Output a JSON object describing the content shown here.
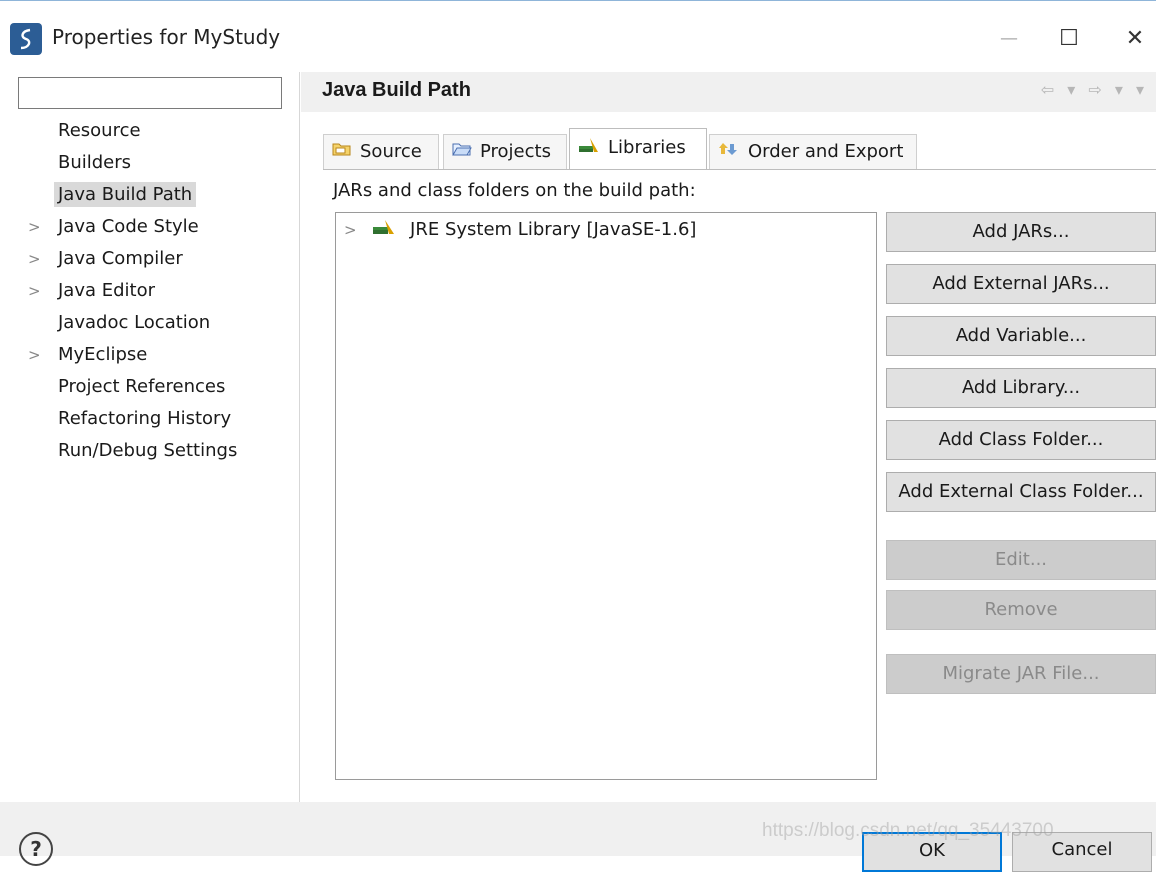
{
  "window": {
    "title": "Properties for MyStudy",
    "minimize": "—",
    "maximize": "☐",
    "close": "✕"
  },
  "nav": {
    "filter_value": "",
    "items": [
      {
        "label": "Resource",
        "expandable": false,
        "selected": false
      },
      {
        "label": "Builders",
        "expandable": false,
        "selected": false
      },
      {
        "label": "Java Build Path",
        "expandable": false,
        "selected": true
      },
      {
        "label": "Java Code Style",
        "expandable": true,
        "selected": false
      },
      {
        "label": "Java Compiler",
        "expandable": true,
        "selected": false
      },
      {
        "label": "Java Editor",
        "expandable": true,
        "selected": false
      },
      {
        "label": "Javadoc Location",
        "expandable": false,
        "selected": false
      },
      {
        "label": "MyEclipse",
        "expandable": true,
        "selected": false
      },
      {
        "label": "Project References",
        "expandable": false,
        "selected": false
      },
      {
        "label": "Refactoring History",
        "expandable": false,
        "selected": false
      },
      {
        "label": "Run/Debug Settings",
        "expandable": false,
        "selected": false
      }
    ],
    "chevron": ">"
  },
  "page": {
    "title": "Java Build Path",
    "history_nav": "⇦ ▾ ⇨ ▾ ▾"
  },
  "tabs": [
    {
      "label": "Source",
      "icon": "source-folder-icon",
      "active": false
    },
    {
      "label": "Projects",
      "icon": "project-folder-icon",
      "active": false
    },
    {
      "label": "Libraries",
      "icon": "library-icon",
      "active": true
    },
    {
      "label": "Order and Export",
      "icon": "order-export-icon",
      "active": false
    }
  ],
  "libraries": {
    "label": "JARs and class folders on the build path:",
    "entries": [
      {
        "label": "JRE System Library [JavaSE-1.6]",
        "icon": "library-icon"
      }
    ],
    "chevron": ">"
  },
  "buttons": [
    {
      "label": "Add JARs...",
      "enabled": true
    },
    {
      "label": "Add External JARs...",
      "enabled": true
    },
    {
      "label": "Add Variable...",
      "enabled": true
    },
    {
      "label": "Add Library...",
      "enabled": true
    },
    {
      "label": "Add Class Folder...",
      "enabled": true
    },
    {
      "label": "Add External Class Folder...",
      "enabled": true
    },
    {
      "label": "Edit...",
      "enabled": false
    },
    {
      "label": "Remove",
      "enabled": false
    },
    {
      "label": "Migrate JAR File...",
      "enabled": false
    }
  ],
  "footer": {
    "help": "?",
    "ok": "OK",
    "cancel": "Cancel",
    "watermark": "https://blog.csdn.net/qq_35443700"
  },
  "colors": {
    "accent": "#0078d7",
    "library_green": "#3a8a3a",
    "library_gold": "#d9a000"
  }
}
